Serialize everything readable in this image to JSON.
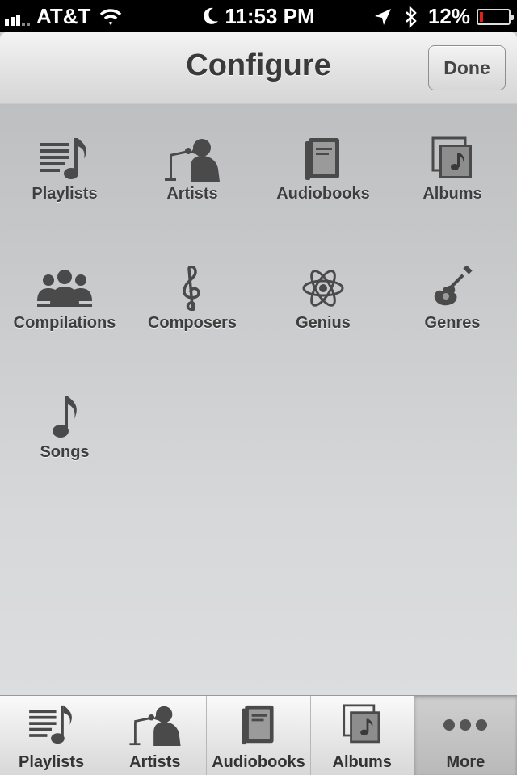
{
  "status_bar": {
    "carrier": "AT&T",
    "time": "11:53 PM",
    "battery": "12%",
    "battery_level": 0.12,
    "battery_color": "#e0201c"
  },
  "nav": {
    "title": "Configure",
    "done_label": "Done"
  },
  "grid": [
    {
      "label": "Playlists",
      "icon": "playlists-icon"
    },
    {
      "label": "Artists",
      "icon": "artist-icon"
    },
    {
      "label": "Audiobooks",
      "icon": "audiobook-icon"
    },
    {
      "label": "Albums",
      "icon": "album-icon"
    },
    {
      "label": "Compilations",
      "icon": "compilations-icon"
    },
    {
      "label": "Composers",
      "icon": "treble-clef-icon"
    },
    {
      "label": "Genius",
      "icon": "atom-icon"
    },
    {
      "label": "Genres",
      "icon": "guitar-icon"
    },
    {
      "label": "Songs",
      "icon": "music-note-icon"
    }
  ],
  "tabs": [
    {
      "label": "Playlists",
      "icon": "playlists-icon",
      "selected": false
    },
    {
      "label": "Artists",
      "icon": "artist-icon",
      "selected": false
    },
    {
      "label": "Audiobooks",
      "icon": "audiobook-icon",
      "selected": false
    },
    {
      "label": "Albums",
      "icon": "album-icon",
      "selected": false
    },
    {
      "label": "More",
      "icon": "more-icon",
      "selected": true
    }
  ]
}
